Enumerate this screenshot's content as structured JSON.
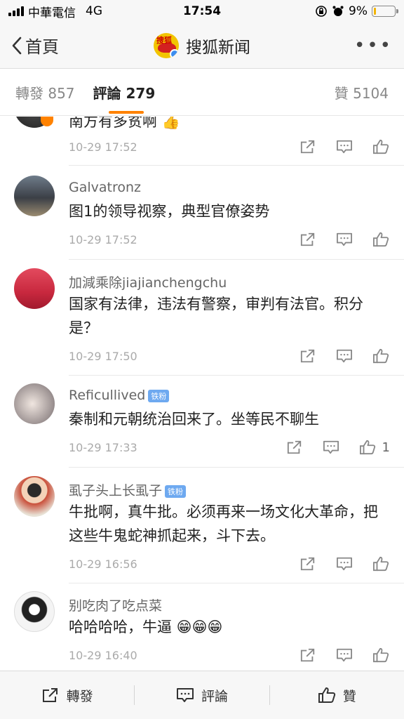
{
  "status_bar": {
    "carrier": "中華電信",
    "network": "4G",
    "time": "17:54",
    "battery": "9%",
    "battery_level": 0.09
  },
  "nav": {
    "back_label": "首頁",
    "title": "搜狐新闻",
    "logo_text": "搜狐",
    "more_icon": "more-dots-icon"
  },
  "tabs": {
    "repost": "轉發 857",
    "comments": "評論 279",
    "likes": "贊 5104"
  },
  "comments": [
    {
      "name": "",
      "badge": "",
      "text": "南方有多贫啊 👍",
      "time": "10-29 17:52",
      "like_count": ""
    },
    {
      "name": "Galvatronz",
      "badge": "",
      "text": "图1的领导视察，典型官僚姿势",
      "time": "10-29 17:52",
      "like_count": ""
    },
    {
      "name": "加減乘除jiajianchengchu",
      "badge": "",
      "text": "国家有法律，违法有警察，审判有法官。积分是？",
      "time": "10-29 17:50",
      "like_count": ""
    },
    {
      "name": "Reficullived",
      "badge": "铁粉",
      "text": "秦制和元朝统治回来了。坐等民不聊生",
      "time": "10-29 17:33",
      "like_count": "1"
    },
    {
      "name": "虱子头上长虱子",
      "badge": "铁粉",
      "text": "牛批啊，真牛批。必须再来一场文化大革命，把这些牛鬼蛇神抓起来，斗下去。",
      "time": "10-29 16:56",
      "like_count": ""
    },
    {
      "name": "别吃肉了吃点菜",
      "badge": "",
      "text": "哈哈哈哈，牛逼 😁😁😁",
      "time": "10-29 16:40",
      "like_count": ""
    }
  ],
  "toolbar": {
    "repost": "轉發",
    "comment": "評論",
    "like": "贊"
  },
  "colors": {
    "accent": "#ff8200",
    "badge": "#6ea9f0"
  }
}
